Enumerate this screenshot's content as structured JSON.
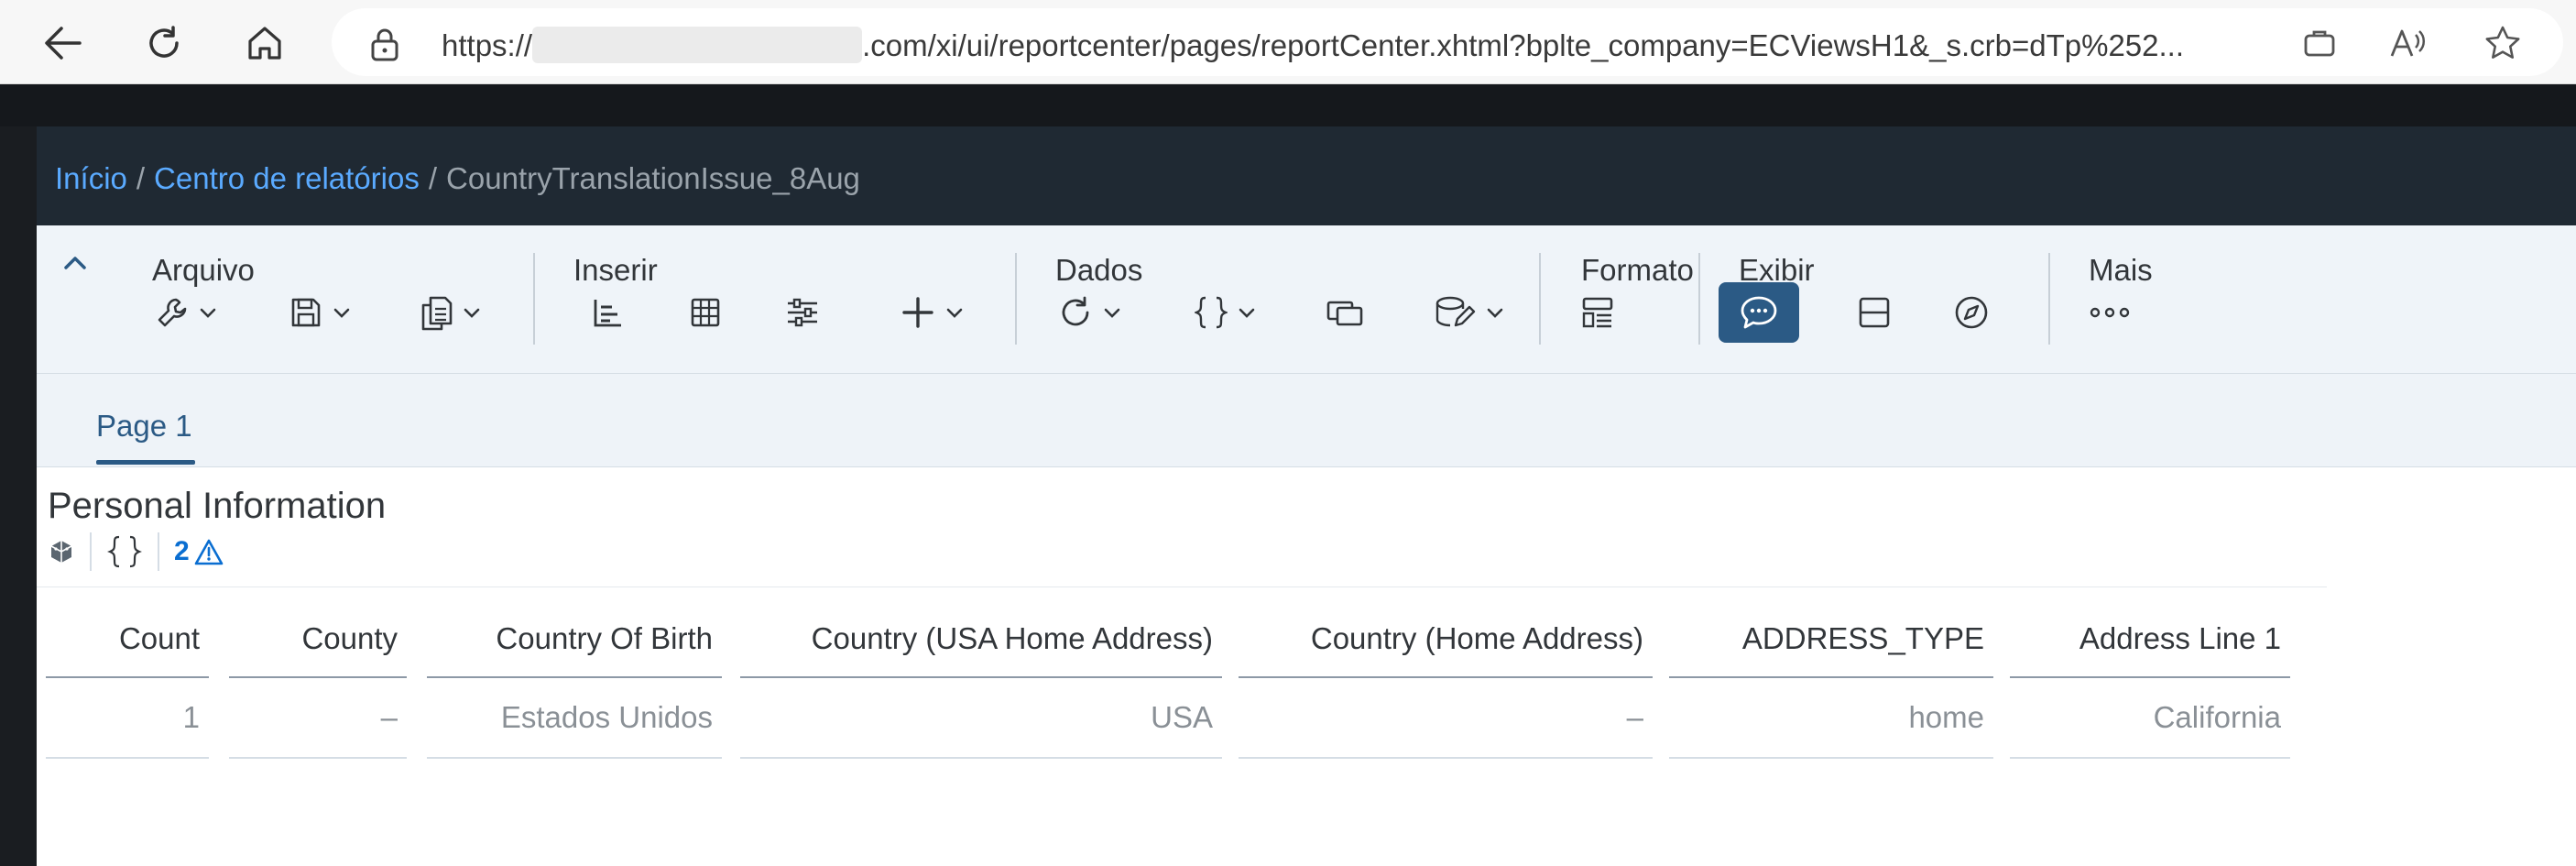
{
  "browser": {
    "url_prefix": "https://",
    "url_suffix": ".com/xi/ui/reportcenter/pages/reportCenter.xhtml?bplte_company=ECViewsH1&_s.crb=dTp%252...",
    "icons": [
      "back-icon",
      "refresh-icon",
      "home-icon",
      "lock-icon",
      "app-available-icon",
      "read-aloud-icon",
      "favorite-star-icon"
    ]
  },
  "breadcrumb": {
    "home": "Início",
    "report_center": "Centro de relatórios",
    "separator": "/",
    "current": "CountryTranslationIssue_8Aug"
  },
  "toolbar": {
    "groups": {
      "file": "Arquivo",
      "insert": "Inserir",
      "data": "Dados",
      "format": "Formato",
      "view": "Exibir",
      "more": "Mais"
    },
    "icons": {
      "file": [
        "wrench-icon",
        "save-icon",
        "copy-icon"
      ],
      "insert": [
        "bar-chart-icon",
        "table-icon",
        "filter-sliders-icon",
        "add-icon"
      ],
      "data": [
        "refresh-icon",
        "braces-icon",
        "tabs-icon",
        "edit-data-icon"
      ],
      "format": [
        "layout-icon"
      ],
      "view": [
        "comment-icon",
        "split-icon",
        "compass-icon"
      ],
      "more": [
        "more-icon"
      ]
    },
    "colors": {
      "active_button": "#2b5a85",
      "link": "#5aaaff"
    }
  },
  "tabs": [
    {
      "label": "Page 1",
      "selected": true
    }
  ],
  "report": {
    "title": "Personal Information",
    "warning_count": "2",
    "columns": [
      "Count",
      "County",
      "Country Of Birth",
      "Country (USA Home Address)",
      "Country (Home Address)",
      "ADDRESS_TYPE",
      "Address Line 1"
    ],
    "rows": [
      [
        "1",
        "–",
        "Estados Unidos",
        "USA",
        "–",
        "home",
        "California"
      ]
    ]
  }
}
